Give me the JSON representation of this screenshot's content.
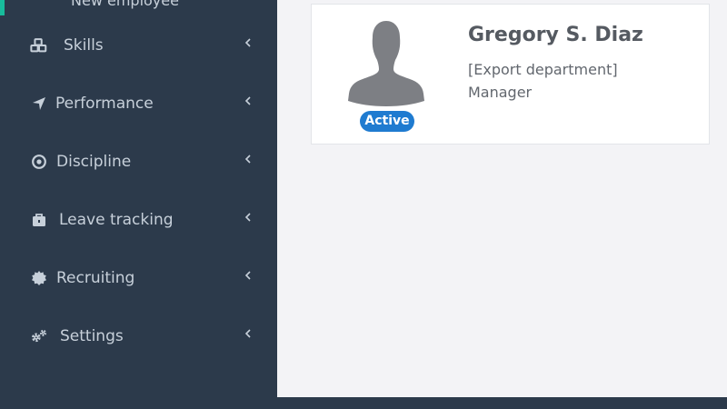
{
  "sidebar": {
    "partial_sub_item": "New employee",
    "items": [
      {
        "label": "Skills",
        "icon": "cubes-icon"
      },
      {
        "label": "Performance",
        "icon": "location-arrow-icon"
      },
      {
        "label": "Discipline",
        "icon": "target-icon"
      },
      {
        "label": "Leave tracking",
        "icon": "briefcase-icon"
      },
      {
        "label": "Recruiting",
        "icon": "certificate-icon"
      },
      {
        "label": "Settings",
        "icon": "cogs-icon"
      }
    ]
  },
  "employee": {
    "name": "Gregory S. Diaz",
    "department": "[Export department]",
    "position": "Manager",
    "status": "Active"
  },
  "colors": {
    "sidebar_bg": "#2c3a4b",
    "accent": "#18bc9c",
    "badge_bg": "#1f7bd0",
    "content_bg": "#f3f3f6"
  }
}
